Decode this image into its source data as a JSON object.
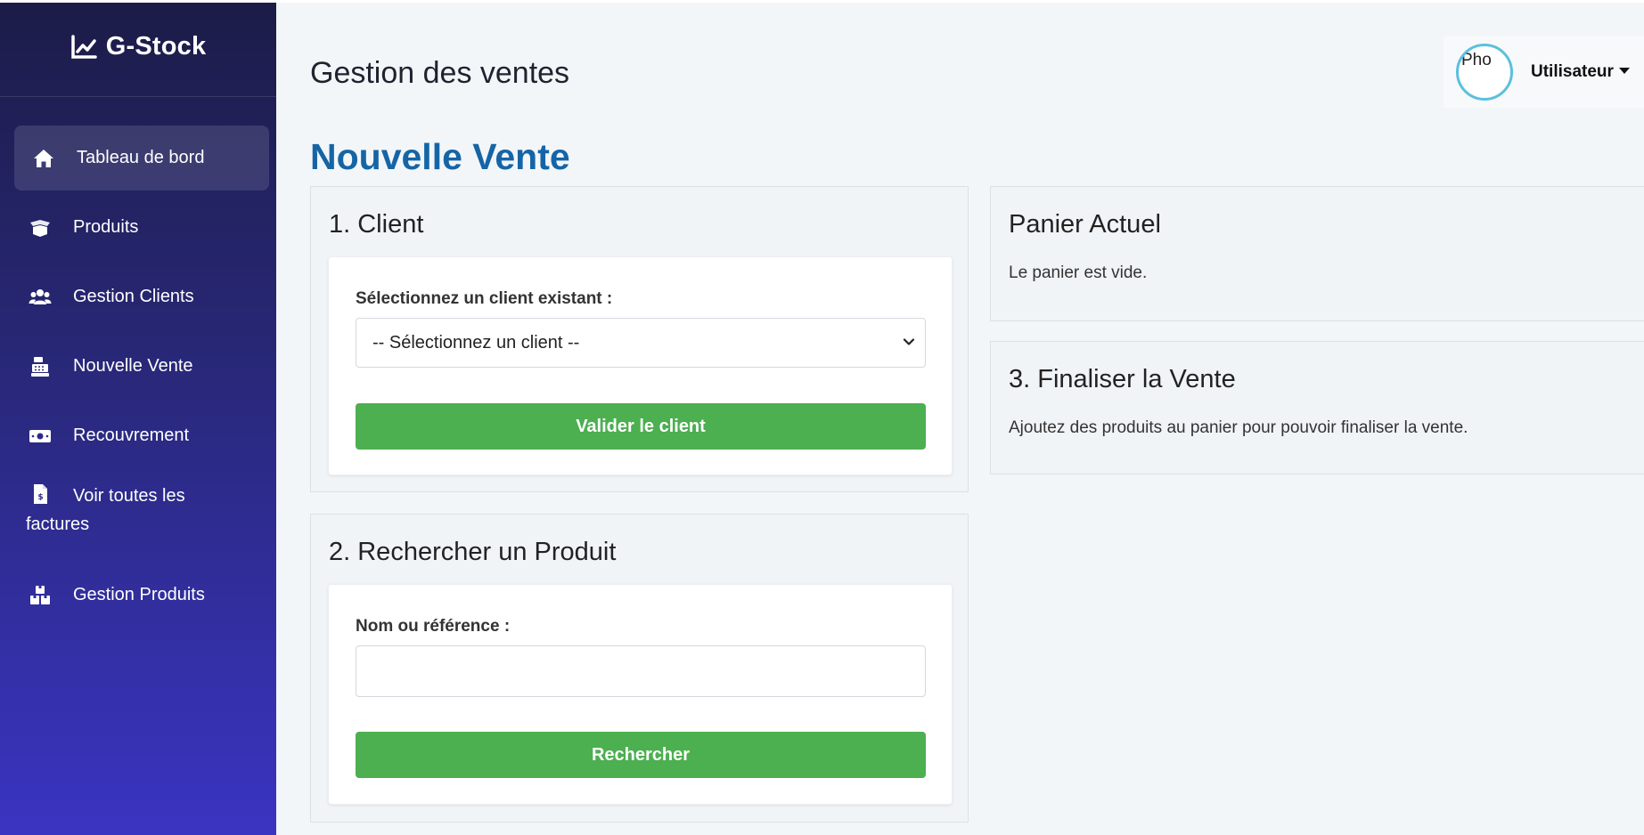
{
  "brand": {
    "title": "G-Stock",
    "icon": "chart-line-icon"
  },
  "sidebar": {
    "items": [
      {
        "label": "Tableau de bord",
        "icon": "home-icon",
        "active": true
      },
      {
        "label": "Produits",
        "icon": "box-open-icon"
      },
      {
        "label": "Gestion Clients",
        "icon": "users-icon"
      },
      {
        "label": "Nouvelle Vente",
        "icon": "cash-register-icon"
      },
      {
        "label": "Recouvrement",
        "icon": "money-bill-icon"
      },
      {
        "label_line1": "Voir toutes les",
        "label_line2": "factures",
        "icon": "file-invoice-dollar-icon"
      },
      {
        "label": "Gestion Produits",
        "icon": "boxes-icon"
      }
    ]
  },
  "header": {
    "title": "Gestion des ventes",
    "user": {
      "avatar_alt": "Pho",
      "name": "Utilisateur"
    }
  },
  "main": {
    "section_title": "Nouvelle Vente",
    "client": {
      "heading": "1. Client",
      "label": "Sélectionnez un client existant :",
      "select_value": "-- Sélectionnez un client --",
      "button": "Valider le client"
    },
    "search": {
      "heading": "2. Rechercher un Produit",
      "label": "Nom ou référence :",
      "input_value": "",
      "button": "Rechercher"
    },
    "cart": {
      "heading": "Panier Actuel",
      "text": "Le panier est vide."
    },
    "finalize": {
      "heading": "3. Finaliser la Vente",
      "text": "Ajoutez des produits au panier pour pouvoir finaliser la vente."
    }
  },
  "colors": {
    "accent_green": "#4caf50",
    "title_blue": "#1565a6",
    "sidebar_top": "#1c1c48",
    "sidebar_bottom": "#3a34c2",
    "avatar_ring": "#5bc0de"
  }
}
